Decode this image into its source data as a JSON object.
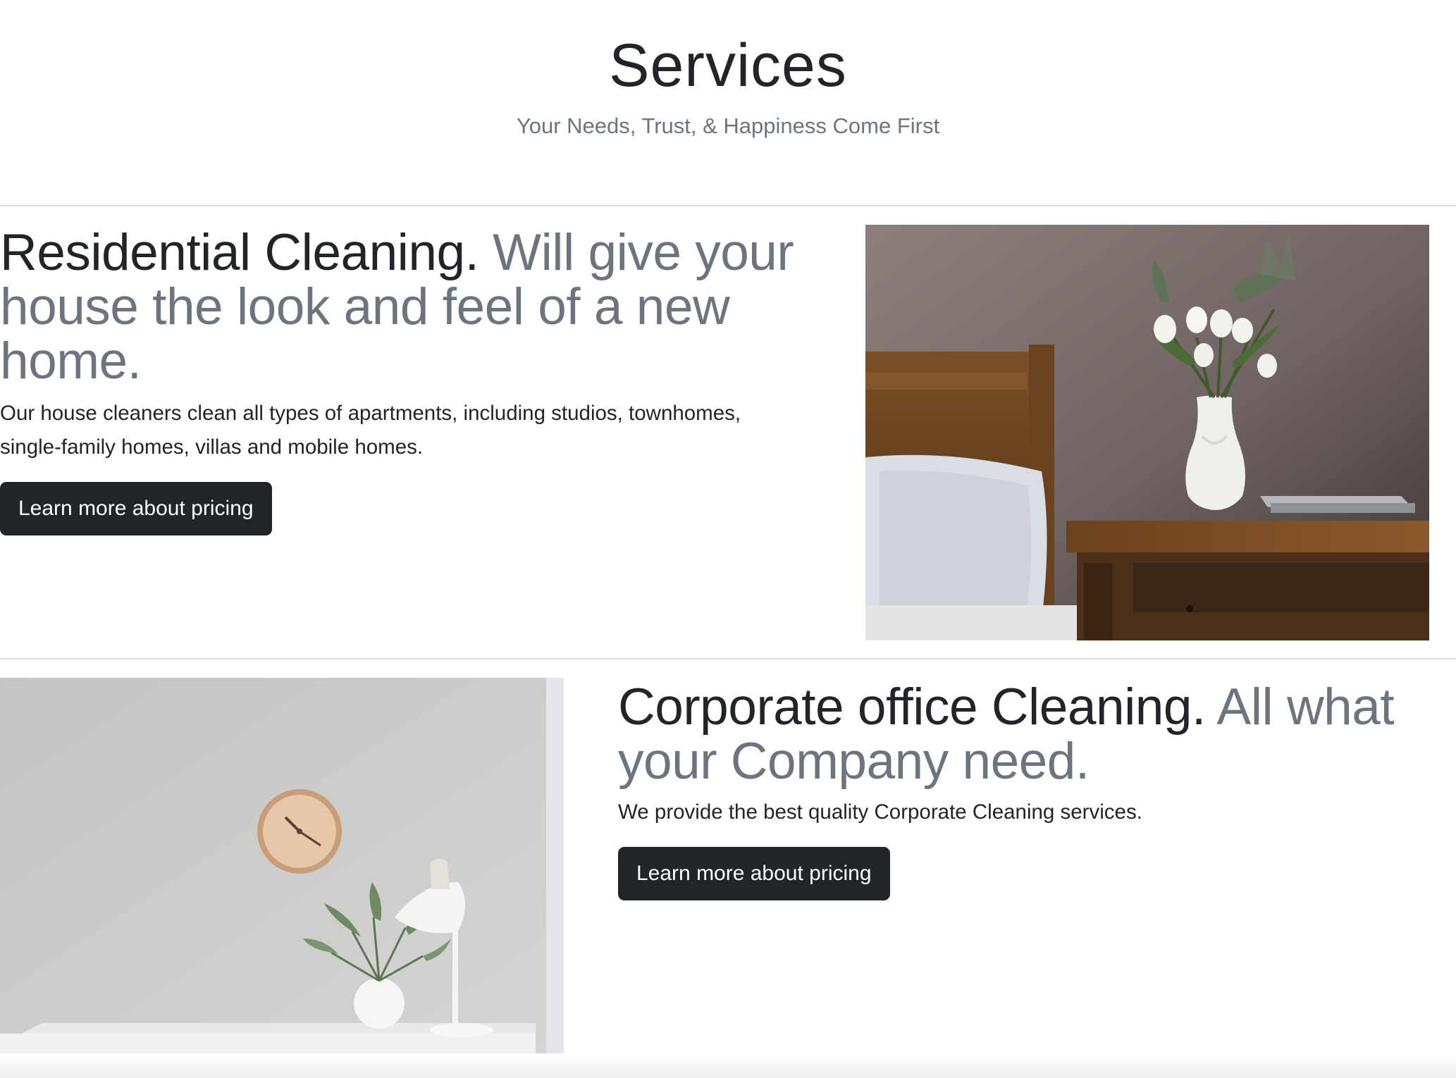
{
  "header": {
    "title": "Services",
    "subtitle": "Your Needs, Trust, & Happiness Come First"
  },
  "features": [
    {
      "heading": "Residential Cleaning.",
      "heading_muted": "Will give your house the look and feel of a new home.",
      "text": "Our house cleaners clean all types of apartments, including studios, townhomes, single-family homes, villas and mobile homes.",
      "button_label": "Learn more about pricing",
      "image": "bedroom-nightstand-photo"
    },
    {
      "heading": "Corporate office Cleaning.",
      "heading_muted": "All what your Company need.",
      "text": "We provide the best quality Corporate Cleaning services.",
      "button_label": "Learn more about pricing",
      "image": "office-desk-clock-photo"
    }
  ],
  "colors": {
    "text": "#212529",
    "muted": "#6c757d",
    "button": "#212529",
    "divider": "#dee2e6"
  }
}
